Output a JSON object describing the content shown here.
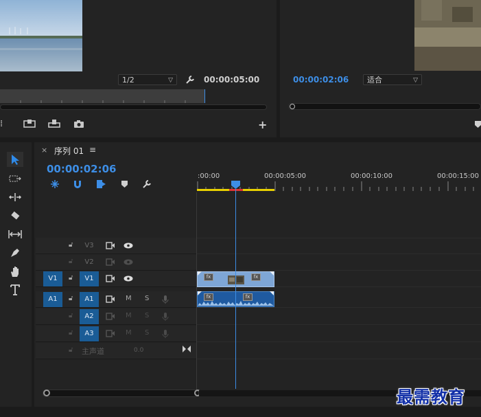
{
  "source_monitor": {
    "zoom_value": "1/2",
    "duration": "00:00:05:00"
  },
  "program_monitor": {
    "timecode": "00:00:02:06",
    "fit_value": "适合"
  },
  "timeline": {
    "close_label": "×",
    "sequence_name": "序列 01",
    "menu_label": "≡",
    "timecode": "00:00:02:06",
    "ruler": [
      ":00:00",
      "00:00:05:00",
      "00:00:10:00",
      "00:00:15:00"
    ],
    "tracks": {
      "v3": "V3",
      "v2": "V2",
      "v1_src": "V1",
      "v1": "V1",
      "a1_src": "A1",
      "a1": "A1",
      "a2": "A2",
      "a3": "A3"
    },
    "mute": "M",
    "solo": "S",
    "master_label": "主声道",
    "master_value": "0.0",
    "clip_badge": "fx"
  },
  "watermark": "最需教育",
  "colors": {
    "accent_blue": "#3d8ee6",
    "track_target": "#1a5c96",
    "video_clip": "#7ea6d6",
    "audio_clip": "#1f5aa0",
    "work_area": "#e8d000"
  }
}
